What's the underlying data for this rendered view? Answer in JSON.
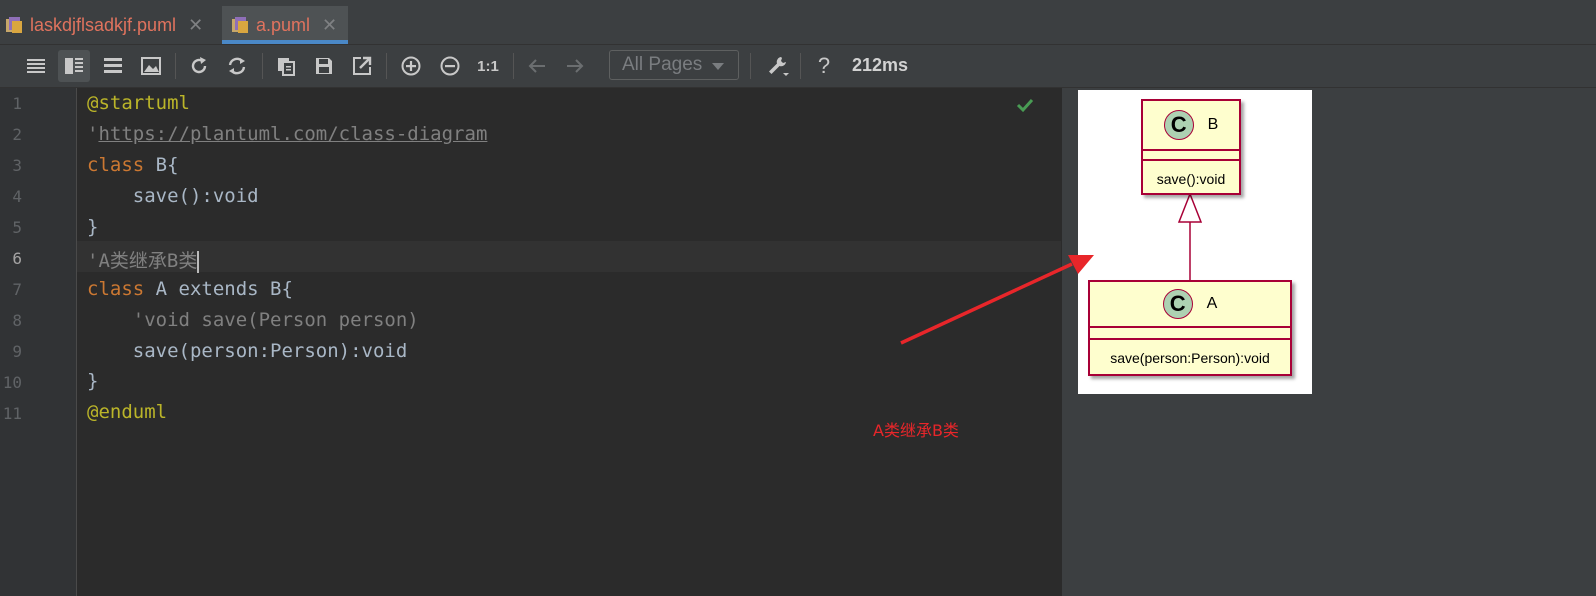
{
  "tabs": [
    {
      "label": "laskdjflsadkjf.puml",
      "active": false
    },
    {
      "label": "a.puml",
      "active": true
    }
  ],
  "toolbar": {
    "page_select": "All Pages",
    "zoom_actual_label": "1:1",
    "help_label": "?",
    "render_time": "212ms",
    "icons": [
      "list-icon",
      "split-view-icon",
      "editor-only-icon",
      "image-icon",
      "refresh-icon",
      "sync-icon",
      "copy-icon",
      "save-icon",
      "export-icon",
      "zoom-in-icon",
      "zoom-out-icon",
      "back-arrow-icon",
      "forward-arrow-icon",
      "wrench-icon"
    ]
  },
  "editor": {
    "line_numbers": [
      "1",
      "2",
      "3",
      "4",
      "5",
      "6",
      "7",
      "8",
      "9",
      "10",
      "11"
    ],
    "current_line": 6,
    "lines": {
      "l1": "@startuml",
      "l2_quote": "'",
      "l2_url": "https://plantuml.com/class-diagram",
      "l3_kw": "class",
      "l3_rest": " B{",
      "l4": "    save():void",
      "l5": "}",
      "l6": "'A类继承B类",
      "l7_kw": "class",
      "l7_rest": " A extends B{",
      "l8": "    'void save(Person person)",
      "l9": "    save(person:Person):void",
      "l10": "}",
      "l11": "@enduml"
    }
  },
  "diagram": {
    "class_b": {
      "stereotype": "C",
      "name": "B",
      "method": "save():void"
    },
    "class_a": {
      "stereotype": "C",
      "name": "A",
      "method": "save(person:Person):void"
    }
  },
  "annotation": {
    "text": "A类继承B类",
    "color": "#e8262a"
  },
  "colors": {
    "keyword_orange": "#cc7832",
    "annotation_yellow": "#bbb529",
    "comment_gray": "#808080",
    "uml_border": "#a80036",
    "uml_fill": "#fefece",
    "uml_circle": "#add1b2",
    "tab_underline": "#4a88c7"
  }
}
